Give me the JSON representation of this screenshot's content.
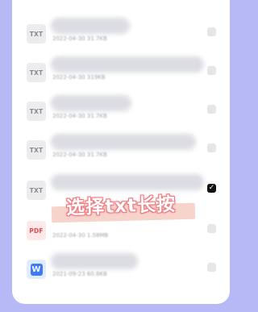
{
  "files": [
    {
      "type": "TXT",
      "date": "2022-04-30",
      "size": "31.7KB",
      "selected": false
    },
    {
      "type": "TXT",
      "date": "2022-04-30",
      "size": "319KB",
      "selected": false
    },
    {
      "type": "TXT",
      "date": "2022-04-30",
      "size": "31.7KB",
      "selected": false
    },
    {
      "type": "TXT",
      "date": "2022-04-30",
      "size": "31.7KB",
      "selected": false
    },
    {
      "type": "TXT",
      "date": "",
      "size": "",
      "selected": true
    },
    {
      "type": "PDF",
      "date": "2022-04-30",
      "size": "1.58MB",
      "selected": false
    },
    {
      "type": "W",
      "date": "2021-09-23",
      "size": "60.8KB",
      "selected": false
    }
  ],
  "caption": "选择txt长按",
  "check_mark": "✓",
  "colors": {
    "background": "#b7b9f6",
    "pdf": "#e5484d",
    "word": "#3b7bf6",
    "checked": "#111111",
    "caption_outline": "#ee6e76"
  }
}
